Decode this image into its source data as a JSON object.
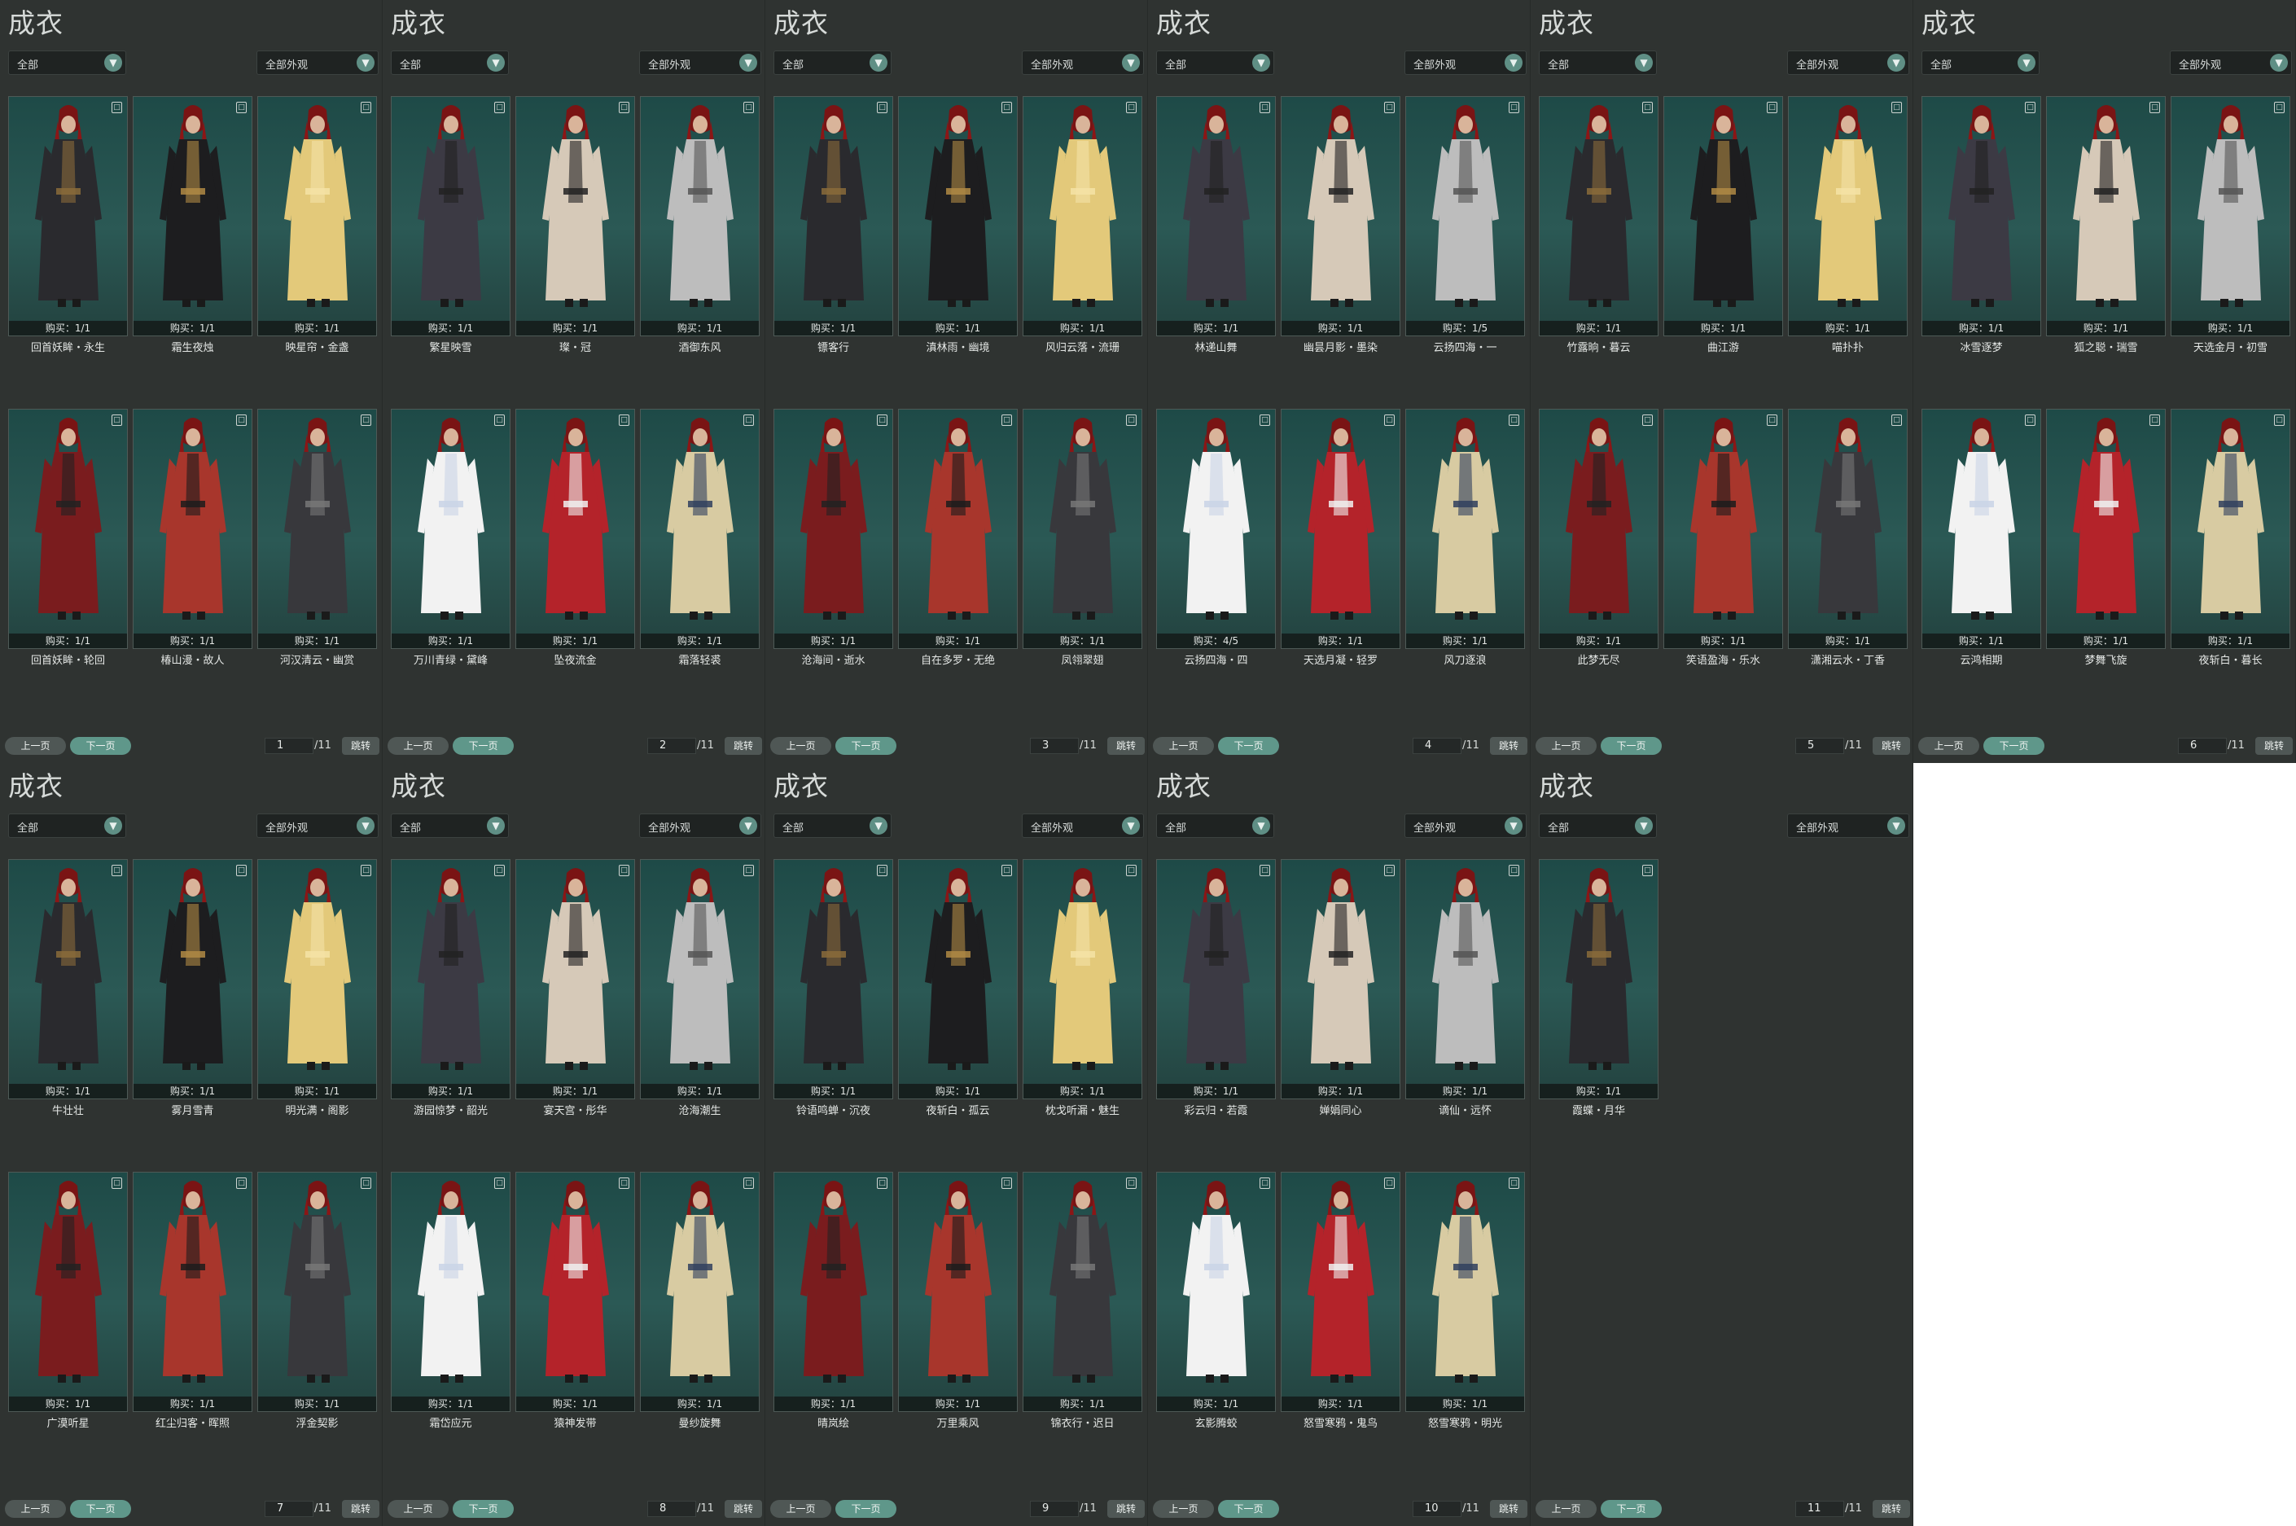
{
  "pages": [
    {
      "title": "成衣",
      "filter": "全部",
      "view_filter": "全部外观",
      "prev_label": "上一页",
      "next_label": "下一页",
      "page_number": "1",
      "page_total": "/11",
      "jump_label": "跳转",
      "items": [
        {
          "name": "回首妖眸・永生",
          "purchase": "购买：1/1"
        },
        {
          "name": "霜生夜烛",
          "purchase": "购买：1/1"
        },
        {
          "name": "映星帘・金盏",
          "purchase": "购买：1/1"
        },
        {
          "name": "回首妖眸・轮回",
          "purchase": "购买：1/1"
        },
        {
          "name": "椿山漫・故人",
          "purchase": "购买：1/1"
        },
        {
          "name": "河汉清云・幽赏",
          "purchase": "购买：1/1"
        }
      ]
    },
    {
      "title": "成衣",
      "filter": "全部",
      "view_filter": "全部外观",
      "prev_label": "上一页",
      "next_label": "下一页",
      "page_number": "2",
      "page_total": "/11",
      "jump_label": "跳转",
      "items": [
        {
          "name": "繁星映雪",
          "purchase": "购买：1/1"
        },
        {
          "name": "璨・冠",
          "purchase": "购买：1/1"
        },
        {
          "name": "酒御东风",
          "purchase": "购买：1/1"
        },
        {
          "name": "万川青绿・黛峰",
          "purchase": "购买：1/1"
        },
        {
          "name": "坠夜流金",
          "purchase": "购买：1/1"
        },
        {
          "name": "霜落轻裘",
          "purchase": "购买：1/1"
        }
      ]
    },
    {
      "title": "成衣",
      "filter": "全部",
      "view_filter": "全部外观",
      "prev_label": "上一页",
      "next_label": "下一页",
      "page_number": "3",
      "page_total": "/11",
      "jump_label": "跳转",
      "items": [
        {
          "name": "镖客行",
          "purchase": "购买：1/1"
        },
        {
          "name": "滇林雨・幽境",
          "purchase": "购买：1/1"
        },
        {
          "name": "风归云落・流珊",
          "purchase": "购买：1/1"
        },
        {
          "name": "沧海间・逝水",
          "purchase": "购买：1/1"
        },
        {
          "name": "自在多罗・无绝",
          "purchase": "购买：1/1"
        },
        {
          "name": "凤翎翠翅",
          "purchase": "购买：1/1"
        }
      ]
    },
    {
      "title": "成衣",
      "filter": "全部",
      "view_filter": "全部外观",
      "prev_label": "上一页",
      "next_label": "下一页",
      "page_number": "4",
      "page_total": "/11",
      "jump_label": "跳转",
      "items": [
        {
          "name": "林递山舞",
          "purchase": "购买：1/1"
        },
        {
          "name": "幽昙月影・墨染",
          "purchase": "购买：1/1"
        },
        {
          "name": "云扬四海・一",
          "purchase": "购买：1/5"
        },
        {
          "name": "云扬四海・四",
          "purchase": "购买：4/5"
        },
        {
          "name": "天选月凝・轻罗",
          "purchase": "购买：1/1"
        },
        {
          "name": "风刀逐浪",
          "purchase": "购买：1/1"
        }
      ]
    },
    {
      "title": "成衣",
      "filter": "全部",
      "view_filter": "全部外观",
      "prev_label": "上一页",
      "next_label": "下一页",
      "page_number": "5",
      "page_total": "/11",
      "jump_label": "跳转",
      "items": [
        {
          "name": "竹露晌・暮云",
          "purchase": "购买：1/1"
        },
        {
          "name": "曲江游",
          "purchase": "购买：1/1"
        },
        {
          "name": "喵扑扑",
          "purchase": "购买：1/1"
        },
        {
          "name": "此梦无尽",
          "purchase": "购买：1/1"
        },
        {
          "name": "笑语盈海・乐水",
          "purchase": "购买：1/1"
        },
        {
          "name": "潇湘云水・丁香",
          "purchase": "购买：1/1"
        }
      ]
    },
    {
      "title": "成衣",
      "filter": "全部",
      "view_filter": "全部外观",
      "prev_label": "上一页",
      "next_label": "下一页",
      "page_number": "6",
      "page_total": "/11",
      "jump_label": "跳转",
      "items": [
        {
          "name": "冰雪逐梦",
          "purchase": "购买：1/1"
        },
        {
          "name": "狐之聪・瑞雪",
          "purchase": "购买：1/1"
        },
        {
          "name": "天选金月・初雪",
          "purchase": "购买：1/1"
        },
        {
          "name": "云鸿相期",
          "purchase": "购买：1/1"
        },
        {
          "name": "梦舞飞旋",
          "purchase": "购买：1/1"
        },
        {
          "name": "夜斩白・暮长",
          "purchase": "购买：1/1"
        }
      ]
    },
    {
      "title": "成衣",
      "filter": "全部",
      "view_filter": "全部外观",
      "prev_label": "上一页",
      "next_label": "下一页",
      "page_number": "7",
      "page_total": "/11",
      "jump_label": "跳转",
      "items": [
        {
          "name": "牛壮壮",
          "purchase": "购买：1/1"
        },
        {
          "name": "雾月雪青",
          "purchase": "购买：1/1"
        },
        {
          "name": "明光满・阁影",
          "purchase": "购买：1/1"
        },
        {
          "name": "广漠听星",
          "purchase": "购买：1/1"
        },
        {
          "name": "红尘归客・晖照",
          "purchase": "购买：1/1"
        },
        {
          "name": "浮金契影",
          "purchase": "购买：1/1"
        }
      ]
    },
    {
      "title": "成衣",
      "filter": "全部",
      "view_filter": "全部外观",
      "prev_label": "上一页",
      "next_label": "下一页",
      "page_number": "8",
      "page_total": "/11",
      "jump_label": "跳转",
      "items": [
        {
          "name": "游园惊梦・韶光",
          "purchase": "购买：1/1"
        },
        {
          "name": "宴天宫・彤华",
          "purchase": "购买：1/1"
        },
        {
          "name": "沧海潮生",
          "purchase": "购买：1/1"
        },
        {
          "name": "霜岱应元",
          "purchase": "购买：1/1"
        },
        {
          "name": "猿神发带",
          "purchase": "购买：1/1"
        },
        {
          "name": "曼纱旋舞",
          "purchase": "购买：1/1"
        }
      ]
    },
    {
      "title": "成衣",
      "filter": "全部",
      "view_filter": "全部外观",
      "prev_label": "上一页",
      "next_label": "下一页",
      "page_number": "9",
      "page_total": "/11",
      "jump_label": "跳转",
      "items": [
        {
          "name": "铃语鸣蝉・沉夜",
          "purchase": "购买：1/1"
        },
        {
          "name": "夜斩白・孤云",
          "purchase": "购买：1/1"
        },
        {
          "name": "枕戈听漏・魅生",
          "purchase": "购买：1/1"
        },
        {
          "name": "晴岚绘",
          "purchase": "购买：1/1"
        },
        {
          "name": "万里乘风",
          "purchase": "购买：1/1"
        },
        {
          "name": "锦衣行・迟日",
          "purchase": "购买：1/1"
        }
      ]
    },
    {
      "title": "成衣",
      "filter": "全部",
      "view_filter": "全部外观",
      "prev_label": "上一页",
      "next_label": "下一页",
      "page_number": "10",
      "page_total": "/11",
      "jump_label": "跳转",
      "items": [
        {
          "name": "彩云归・若霞",
          "purchase": "购买：1/1"
        },
        {
          "name": "婵娟同心",
          "purchase": "购买：1/1"
        },
        {
          "name": "谪仙・远怀",
          "purchase": "购买：1/1"
        },
        {
          "name": "玄影腾蛟",
          "purchase": "购买：1/1"
        },
        {
          "name": "怒雪寒鸦・鬼鸟",
          "purchase": "购买：1/1"
        },
        {
          "name": "怒雪寒鸦・明光",
          "purchase": "购买：1/1"
        }
      ]
    },
    {
      "title": "成衣",
      "filter": "全部",
      "view_filter": "全部外观",
      "prev_label": "上一页",
      "next_label": "下一页",
      "page_number": "11",
      "page_total": "/11",
      "jump_label": "跳转",
      "items": [
        {
          "name": "霞蝶・月华",
          "purchase": "购买：1/1"
        }
      ]
    }
  ]
}
